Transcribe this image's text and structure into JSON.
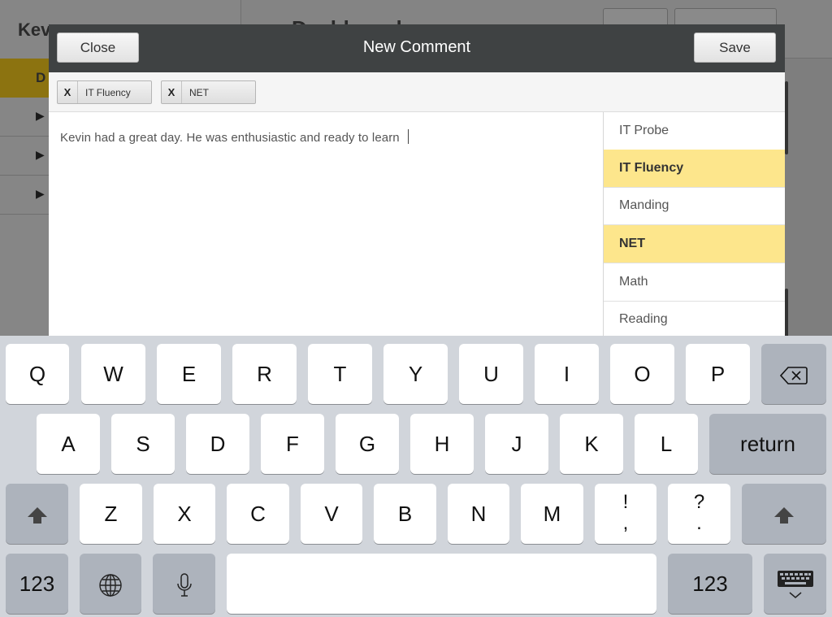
{
  "background": {
    "sidebar_title": "Kev",
    "sidebar_selected": "D",
    "sidebar_rows": [
      "▶",
      "▶",
      "▶"
    ],
    "header_title": "Dashboard"
  },
  "modal": {
    "title": "New Comment",
    "close_label": "Close",
    "save_label": "Save",
    "tags": [
      {
        "remove": "X",
        "label": "IT Fluency"
      },
      {
        "remove": "X",
        "label": "NET"
      }
    ],
    "comment_text": "Kevin had a great day. He was enthusiastic and ready to learn",
    "categories": [
      {
        "label": "IT Probe",
        "selected": false
      },
      {
        "label": "IT Fluency",
        "selected": true
      },
      {
        "label": "Manding",
        "selected": false
      },
      {
        "label": "NET",
        "selected": true
      },
      {
        "label": "Math",
        "selected": false
      },
      {
        "label": "Reading",
        "selected": false
      }
    ],
    "selected_color": "#fde68c",
    "header_color": "#3f4243"
  },
  "keyboard": {
    "row1": [
      "Q",
      "W",
      "E",
      "R",
      "T",
      "Y",
      "U",
      "I",
      "O",
      "P"
    ],
    "row2": [
      "A",
      "S",
      "D",
      "F",
      "G",
      "H",
      "J",
      "K",
      "L"
    ],
    "row3": [
      "Z",
      "X",
      "C",
      "V",
      "B",
      "N",
      "M"
    ],
    "return_label": "return",
    "numbers_label": "123",
    "punct1_top": "!",
    "punct1_bottom": ",",
    "punct2_top": "?",
    "punct2_bottom": ".",
    "icons": {
      "backspace": "backspace-icon",
      "shift": "shift-icon",
      "globe": "globe-icon",
      "mic": "microphone-icon",
      "hide": "hide-keyboard-icon"
    }
  }
}
